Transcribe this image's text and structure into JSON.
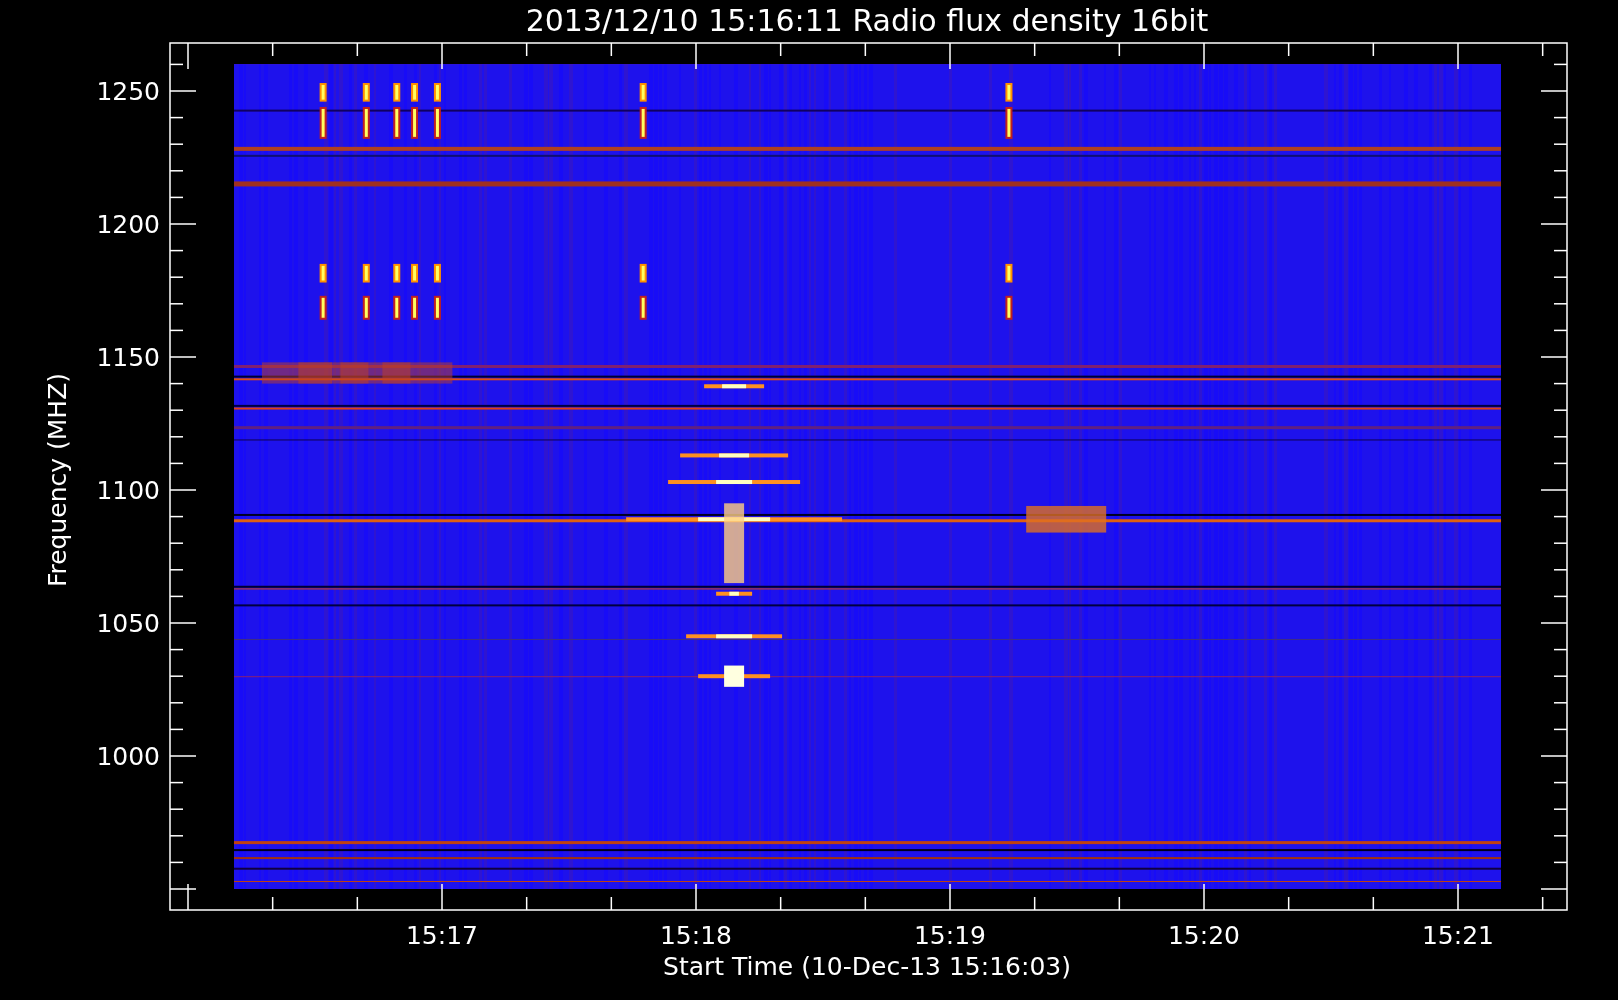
{
  "plot": {
    "title": "2013/12/10 15:16:11 Radio flux density 16bit",
    "xlabel": "Start Time (10-Dec-13 15:16:03)",
    "ylabel": "Frequency (MHZ)",
    "y_tick_labels": [
      "1250",
      "1200",
      "1150",
      "1100",
      "1050",
      "1000"
    ],
    "x_tick_labels": [
      "15:17",
      "15:18",
      "15:19",
      "15:20",
      "15:21"
    ]
  }
}
